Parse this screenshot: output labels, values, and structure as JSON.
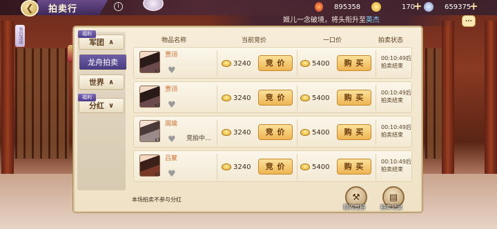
{
  "topbar": {
    "title": "拍卖行",
    "back_glyph": "❮",
    "info_glyph": "i",
    "resources": [
      {
        "icon": "fire-gem-icon",
        "value": "895358"
      },
      {
        "icon": "gold-ingot-icon",
        "value": "170"
      },
      {
        "icon": "jade-coin-icon",
        "value": "659375"
      }
    ],
    "plus": "+"
  },
  "marquee": {
    "text": "姬儿一念破境，将头衔升至",
    "highlight": "英杰"
  },
  "chat_glyph": "…",
  "left_tag": "节日活动",
  "sidebar": {
    "items": [
      {
        "label": "军团",
        "arrow": "∧",
        "badge": "福利"
      },
      {
        "label": "龙舟拍卖",
        "arrow": "",
        "badge": ""
      },
      {
        "label": "世界",
        "arrow": "∧",
        "badge": ""
      },
      {
        "label": "分红",
        "arrow": "∨",
        "badge": "福利"
      }
    ]
  },
  "table": {
    "headers": {
      "item": "物品名称",
      "current_bid": "当前竞价",
      "buyout": "一口价",
      "status": "拍卖状态"
    },
    "bid_label": "竞 价",
    "buy_label": "购 买",
    "heart_glyph": "♥",
    "rows": [
      {
        "name": "贾诩",
        "qty": "x1",
        "current": "3240",
        "buyout": "5400",
        "status": "00:10:49后拍卖结束",
        "bidding": ""
      },
      {
        "name": "贾诩",
        "qty": "x1",
        "current": "3240",
        "buyout": "5400",
        "status": "00:10:49后拍卖结束",
        "bidding": ""
      },
      {
        "name": "周瑜",
        "qty": "x1",
        "current": "3240",
        "buyout": "5400",
        "status": "00:10:49后拍卖结束",
        "bidding": "竞拍中..."
      },
      {
        "name": "吕蒙",
        "qty": "x1",
        "current": "3240",
        "buyout": "5400",
        "status": "00:10:49后拍卖结束",
        "bidding": ""
      }
    ]
  },
  "footer": {
    "notice": "本场拍卖不参与分红",
    "my_bids_label": "我的竞拍",
    "history_label": "拍卖记录"
  },
  "colors": {
    "accent": "#4a3d82",
    "gold": "#eeb553",
    "name": "#d26a2a"
  }
}
